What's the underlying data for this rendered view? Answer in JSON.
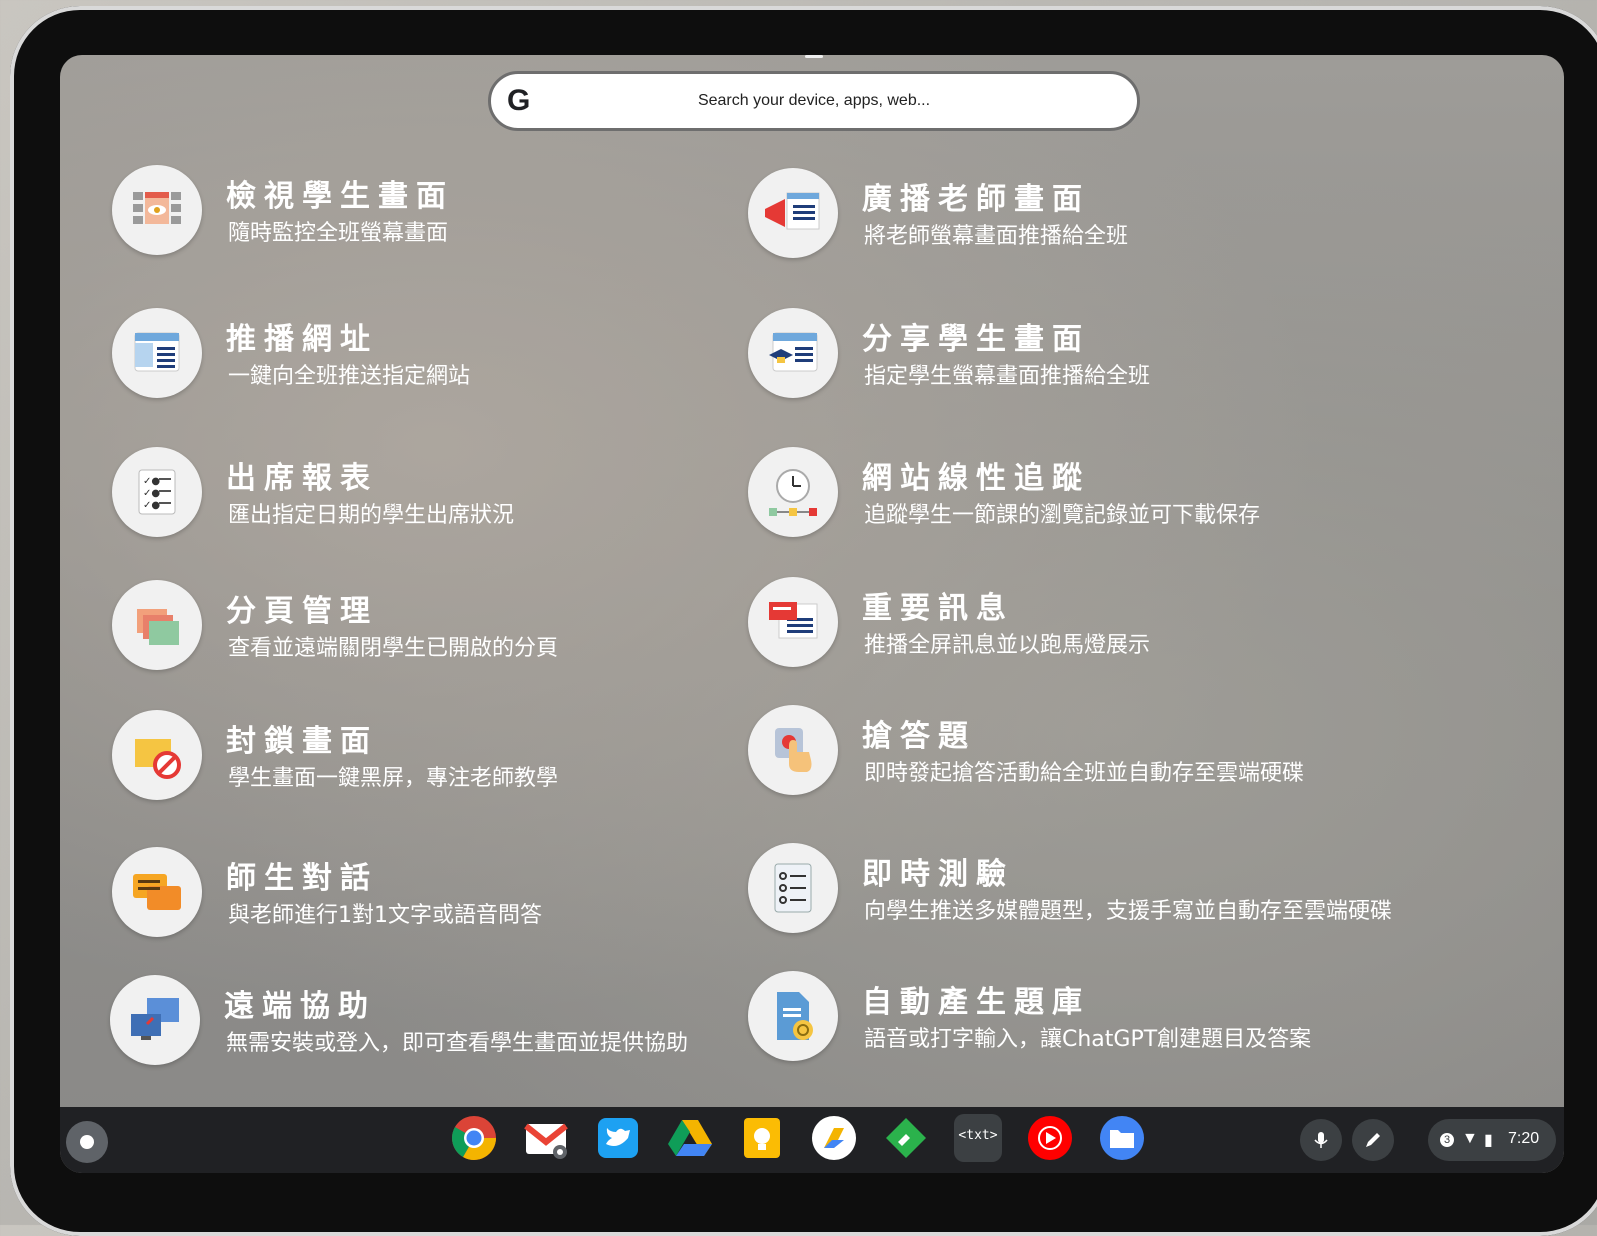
{
  "search": {
    "logo": "G",
    "placeholder": "Search your device, apps, web..."
  },
  "features": [
    {
      "title": "檢視學生畫面",
      "desc": "隨時監控全班螢幕畫面",
      "icon": "monitor-eye-icon"
    },
    {
      "title": "廣播老師畫面",
      "desc": "將老師螢幕畫面推播給全班",
      "icon": "megaphone-icon"
    },
    {
      "title": "推播網址",
      "desc": "一鍵向全班推送指定網站",
      "icon": "webpage-icon"
    },
    {
      "title": "分享學生畫面",
      "desc": "指定學生螢幕畫面推播給全班",
      "icon": "graduation-webpage-icon"
    },
    {
      "title": "出席報表",
      "desc": "匯出指定日期的學生出席狀況",
      "icon": "checklist-icon"
    },
    {
      "title": "網站線性追蹤",
      "desc": "追蹤學生一節課的瀏覽記錄並可下載保存",
      "icon": "clock-timeline-icon"
    },
    {
      "title": "分頁管理",
      "desc": "查看並遠端關閉學生已開啟的分頁",
      "icon": "tabs-icon"
    },
    {
      "title": "重要訊息",
      "desc": "推播全屏訊息並以跑馬燈展示",
      "icon": "message-icon"
    },
    {
      "title": "封鎖畫面",
      "desc": "學生畫面一鍵黑屏，專注老師教學",
      "icon": "block-icon"
    },
    {
      "title": "搶答題",
      "desc": "即時發起搶答活動給全班並自動存至雲端硬碟",
      "icon": "press-button-icon"
    },
    {
      "title": "師生對話",
      "desc": "與老師進行1對1文字或語音問答",
      "icon": "chat-icon"
    },
    {
      "title": "即時測驗",
      "desc": "向學生推送多媒體題型，支援手寫並自動存至雲端硬碟",
      "icon": "quiz-icon"
    },
    {
      "title": "遠端協助",
      "desc": "無需安裝或登入，即可查看學生畫面並提供協助",
      "icon": "remote-monitors-icon"
    },
    {
      "title": "自動產生題庫",
      "desc": "語音或打字輸入，讓ChatGPT創建題目及答案",
      "icon": "ai-document-icon"
    }
  ],
  "shelf": {
    "apps": [
      "chrome-icon",
      "gmail-icon",
      "twitter-icon",
      "drive-icon",
      "keep-icon",
      "slides-icon",
      "feedly-icon",
      "text-editor-icon",
      "youtube-music-icon",
      "files-icon"
    ],
    "text_app_label": "<txt>",
    "notification_count": "3",
    "time": "7:20"
  }
}
